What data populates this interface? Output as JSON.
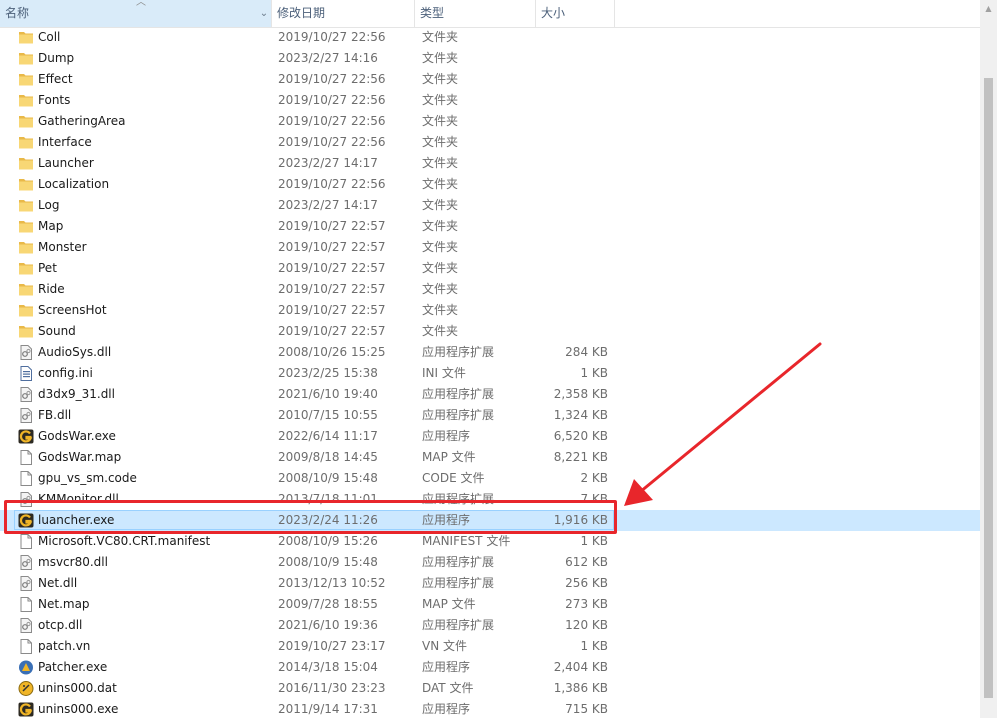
{
  "header": {
    "name": "名称",
    "date": "修改日期",
    "type": "类型",
    "size": "大小"
  },
  "files": [
    {
      "name": "Coll",
      "date": "2019/10/27 22:56",
      "type": "文件夹",
      "size": "",
      "icon": "folder-icon"
    },
    {
      "name": "Dump",
      "date": "2023/2/27 14:16",
      "type": "文件夹",
      "size": "",
      "icon": "folder-icon"
    },
    {
      "name": "Effect",
      "date": "2019/10/27 22:56",
      "type": "文件夹",
      "size": "",
      "icon": "folder-icon"
    },
    {
      "name": "Fonts",
      "date": "2019/10/27 22:56",
      "type": "文件夹",
      "size": "",
      "icon": "folder-icon"
    },
    {
      "name": "GatheringArea",
      "date": "2019/10/27 22:56",
      "type": "文件夹",
      "size": "",
      "icon": "folder-icon"
    },
    {
      "name": "Interface",
      "date": "2019/10/27 22:56",
      "type": "文件夹",
      "size": "",
      "icon": "folder-icon"
    },
    {
      "name": "Launcher",
      "date": "2023/2/27 14:17",
      "type": "文件夹",
      "size": "",
      "icon": "folder-icon"
    },
    {
      "name": "Localization",
      "date": "2019/10/27 22:56",
      "type": "文件夹",
      "size": "",
      "icon": "folder-icon"
    },
    {
      "name": "Log",
      "date": "2023/2/27 14:17",
      "type": "文件夹",
      "size": "",
      "icon": "folder-icon"
    },
    {
      "name": "Map",
      "date": "2019/10/27 22:57",
      "type": "文件夹",
      "size": "",
      "icon": "folder-icon"
    },
    {
      "name": "Monster",
      "date": "2019/10/27 22:57",
      "type": "文件夹",
      "size": "",
      "icon": "folder-icon"
    },
    {
      "name": "Pet",
      "date": "2019/10/27 22:57",
      "type": "文件夹",
      "size": "",
      "icon": "folder-icon"
    },
    {
      "name": "Ride",
      "date": "2019/10/27 22:57",
      "type": "文件夹",
      "size": "",
      "icon": "folder-icon"
    },
    {
      "name": "ScreensHot",
      "date": "2019/10/27 22:57",
      "type": "文件夹",
      "size": "",
      "icon": "folder-icon"
    },
    {
      "name": "Sound",
      "date": "2019/10/27 22:57",
      "type": "文件夹",
      "size": "",
      "icon": "folder-icon"
    },
    {
      "name": "AudioSys.dll",
      "date": "2008/10/26 15:25",
      "type": "应用程序扩展",
      "size": "284 KB",
      "icon": "dll-icon"
    },
    {
      "name": "config.ini",
      "date": "2023/2/25 15:38",
      "type": "INI 文件",
      "size": "1 KB",
      "icon": "ini-icon"
    },
    {
      "name": "d3dx9_31.dll",
      "date": "2021/6/10 19:40",
      "type": "应用程序扩展",
      "size": "2,358 KB",
      "icon": "dll-icon"
    },
    {
      "name": "FB.dll",
      "date": "2010/7/15 10:55",
      "type": "应用程序扩展",
      "size": "1,324 KB",
      "icon": "dll-icon"
    },
    {
      "name": "GodsWar.exe",
      "date": "2022/6/14 11:17",
      "type": "应用程序",
      "size": "6,520 KB",
      "icon": "app-exe-icon"
    },
    {
      "name": "GodsWar.map",
      "date": "2009/8/18 14:45",
      "type": "MAP 文件",
      "size": "8,221 KB",
      "icon": "file-icon"
    },
    {
      "name": "gpu_vs_sm.code",
      "date": "2008/10/9 15:48",
      "type": "CODE 文件",
      "size": "2 KB",
      "icon": "file-icon"
    },
    {
      "name": "KMMonitor.dll",
      "date": "2013/7/18 11:01",
      "type": "应用程序扩展",
      "size": "7 KB",
      "icon": "dll-icon"
    },
    {
      "name": "luancher.exe",
      "date": "2023/2/24 11:26",
      "type": "应用程序",
      "size": "1,916 KB",
      "icon": "app-exe-icon",
      "selected": true
    },
    {
      "name": "Microsoft.VC80.CRT.manifest",
      "date": "2008/10/9 15:26",
      "type": "MANIFEST 文件",
      "size": "1 KB",
      "icon": "file-icon"
    },
    {
      "name": "msvcr80.dll",
      "date": "2008/10/9 15:48",
      "type": "应用程序扩展",
      "size": "612 KB",
      "icon": "dll-icon"
    },
    {
      "name": "Net.dll",
      "date": "2013/12/13 10:52",
      "type": "应用程序扩展",
      "size": "256 KB",
      "icon": "dll-icon"
    },
    {
      "name": "Net.map",
      "date": "2009/7/28 18:55",
      "type": "MAP 文件",
      "size": "273 KB",
      "icon": "file-icon"
    },
    {
      "name": "otcp.dll",
      "date": "2021/6/10 19:36",
      "type": "应用程序扩展",
      "size": "120 KB",
      "icon": "dll-icon"
    },
    {
      "name": "patch.vn",
      "date": "2019/10/27 23:17",
      "type": "VN 文件",
      "size": "1 KB",
      "icon": "file-icon"
    },
    {
      "name": "Patcher.exe",
      "date": "2014/3/18 15:04",
      "type": "应用程序",
      "size": "2,404 KB",
      "icon": "patcher-exe-icon"
    },
    {
      "name": "unins000.dat",
      "date": "2016/11/30 23:23",
      "type": "DAT 文件",
      "size": "1,386 KB",
      "icon": "dat-icon"
    },
    {
      "name": "unins000.exe",
      "date": "2011/9/14 17:31",
      "type": "应用程序",
      "size": "715 KB",
      "icon": "app-exe-icon"
    }
  ],
  "colors": {
    "selection": "#cce8ff",
    "annotation": "#e8262b",
    "folder": "#f8d775"
  }
}
